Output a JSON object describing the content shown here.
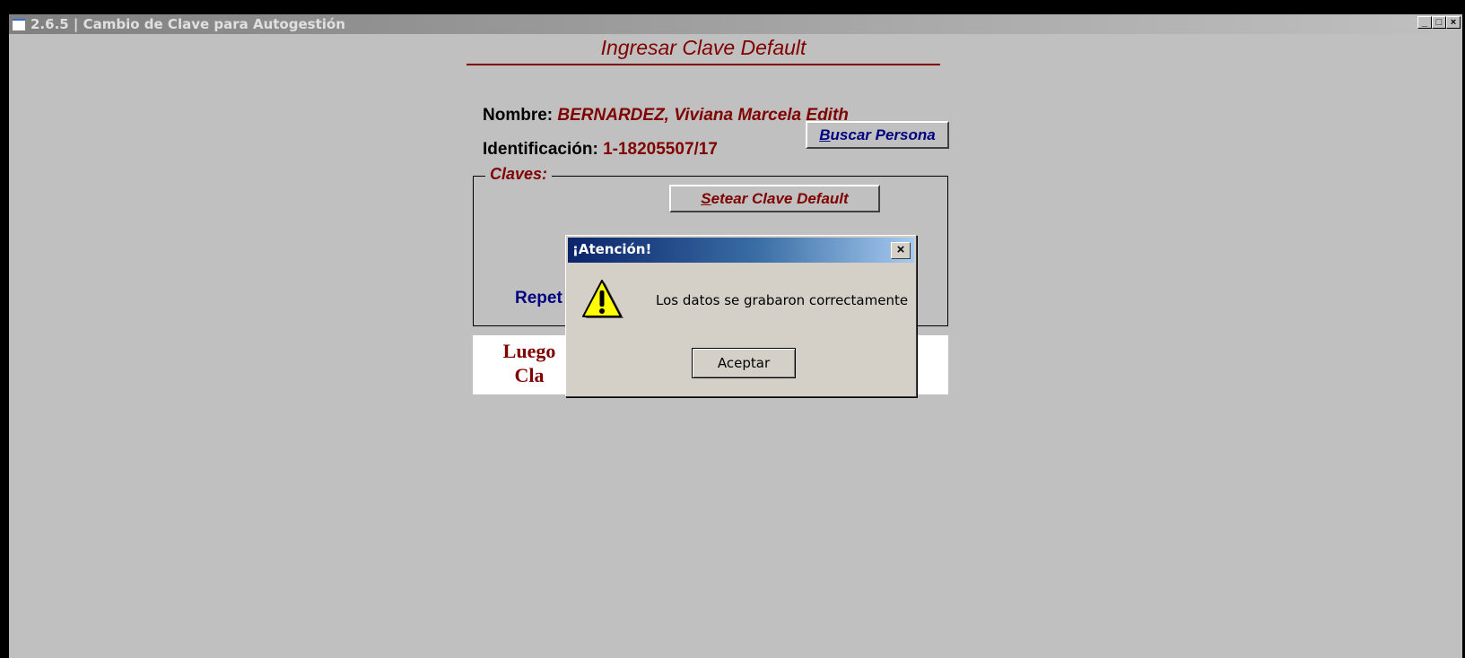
{
  "window": {
    "title": "2.6.5 | Cambio de Clave para Autogestión",
    "controls": {
      "minimize": "_",
      "maximize": "□",
      "close": "×"
    }
  },
  "form": {
    "heading": "Ingresar Clave Default",
    "name_label": "Nombre:",
    "name_value": "BERNARDEZ, Viviana Marcela Edith",
    "id_label": "Identificación:",
    "id_value": "1-18205507/17",
    "search_button": {
      "accel": "B",
      "rest": "uscar Persona"
    },
    "group_title": "Claves:",
    "set_default_button": {
      "accel": "S",
      "rest": "etear Clave Default"
    },
    "repeat_label": "Repet",
    "info_line1": "Luego",
    "info_line2": "Cla"
  },
  "dialog": {
    "title": "¡Atención!",
    "message": "Los datos se grabaron correctamente",
    "ok_button": "Aceptar",
    "icon": "warning-icon"
  },
  "colors": {
    "accent_red": "#800000",
    "accent_blue": "#000080",
    "window_bg": "#c0c0c0",
    "dialog_bg": "#d4d0c8"
  }
}
